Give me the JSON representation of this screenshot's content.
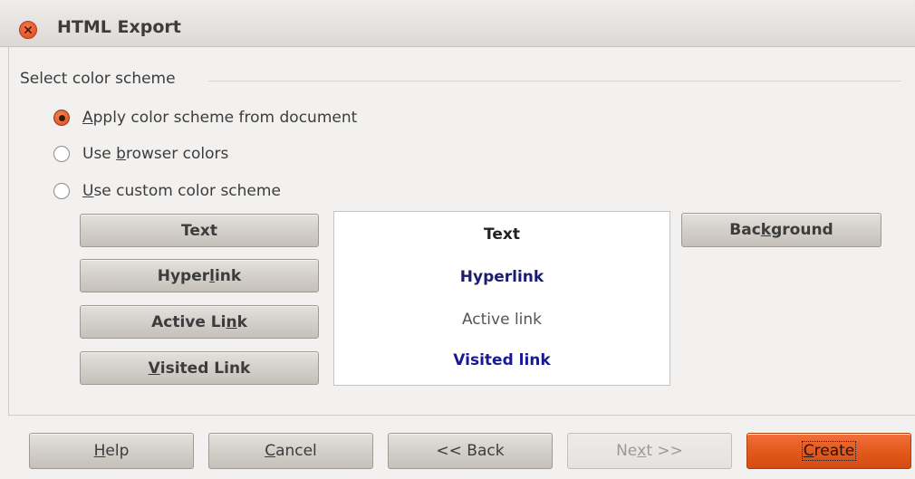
{
  "window": {
    "title": "HTML Export"
  },
  "group": {
    "label": "Select color scheme"
  },
  "options": [
    {
      "pre": "",
      "mn": "A",
      "post": "pply color scheme from document",
      "checked": true
    },
    {
      "pre": "Use ",
      "mn": "b",
      "post": "rowser colors",
      "checked": false
    },
    {
      "pre": "",
      "mn": "U",
      "post": "se custom color scheme",
      "checked": false
    }
  ],
  "color_buttons": {
    "text": {
      "pre": "Text",
      "mn": "",
      "post": ""
    },
    "hyperlink": {
      "pre": "Hyper",
      "mn": "l",
      "post": "ink"
    },
    "active_link": {
      "pre": "Active Li",
      "mn": "n",
      "post": "k"
    },
    "visited_link": {
      "pre": "",
      "mn": "V",
      "post": "isited Link"
    },
    "background": {
      "pre": "Bac",
      "mn": "k",
      "post": "ground"
    }
  },
  "preview": {
    "text": "Text",
    "hyperlink": "Hyperlink",
    "active": "Active link",
    "visited": "Visited link"
  },
  "footer": {
    "help": {
      "pre": "",
      "mn": "H",
      "post": "elp"
    },
    "cancel": {
      "pre": "",
      "mn": "C",
      "post": "ancel"
    },
    "back": {
      "pre": "<< Back",
      "mn": "",
      "post": ""
    },
    "next": {
      "pre": "Ne",
      "mn": "x",
      "post": "t >>"
    },
    "create": {
      "pre": "",
      "mn": "C",
      "post": "reate"
    }
  },
  "colors": {
    "accent": "#dd4814",
    "dialog_bg": "#f2f1f0"
  }
}
